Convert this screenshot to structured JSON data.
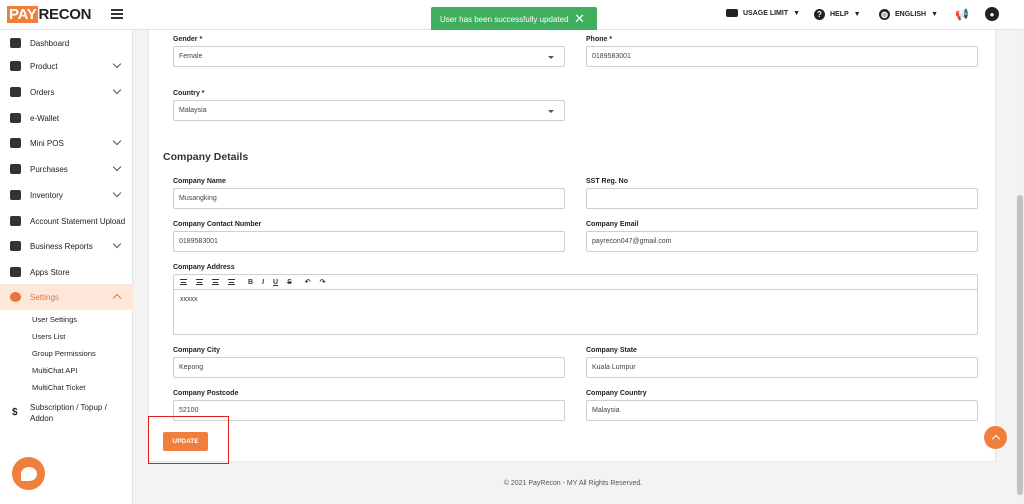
{
  "app": {
    "logo_pay": "PAY",
    "logo_recon": "RECON"
  },
  "toast": {
    "message": "User has been successfully updated",
    "close_icon": "close-icon"
  },
  "header": {
    "usage_limit": "USAGE LIMIT",
    "help": "HELP",
    "language": "ENGLISH"
  },
  "sidebar": {
    "items": [
      {
        "label": "Dashboard",
        "icon": "chart-icon"
      },
      {
        "label": "Product",
        "icon": "box-icon"
      },
      {
        "label": "Orders",
        "icon": "clipboard-icon"
      },
      {
        "label": "e-Wallet",
        "icon": "wallet-icon"
      },
      {
        "label": "Mini POS",
        "icon": "pos-icon"
      },
      {
        "label": "Purchases",
        "icon": "truck-icon"
      },
      {
        "label": "Inventory",
        "icon": "boxes-icon"
      },
      {
        "label": "Account Statement Upload",
        "icon": "upload-icon"
      },
      {
        "label": "Business Reports",
        "icon": "pie-icon"
      },
      {
        "label": "Apps Store",
        "icon": "grid-icon"
      },
      {
        "label": "Settings",
        "icon": "gear-icon"
      }
    ],
    "sub_items": [
      "User Settings",
      "Users List",
      "Group Permissions",
      "MultiChat API",
      "MultiChat Ticket"
    ],
    "subscription": {
      "label_line1": "Subscription / Topup /",
      "label_line2": "Addon"
    }
  },
  "form": {
    "gender": {
      "label": "Gender *",
      "value": "Female"
    },
    "phone": {
      "label": "Phone *",
      "value": "0189583001"
    },
    "country": {
      "label": "Country *",
      "value": "Malaysia"
    },
    "section_title": "Company Details",
    "company_name": {
      "label": "Company Name",
      "value": "Musangking"
    },
    "sst": {
      "label": "SST Reg. No",
      "value": ""
    },
    "company_contact": {
      "label": "Company Contact Number",
      "value": "0189583001"
    },
    "company_email": {
      "label": "Company Email",
      "value": "payrecon047@gmail.com"
    },
    "company_address": {
      "label": "Company Address",
      "value": "xxxxx"
    },
    "company_city": {
      "label": "Company City",
      "value": "Kepong"
    },
    "company_state": {
      "label": "Company State",
      "value": "Kuala Lumpur"
    },
    "company_postcode": {
      "label": "Company Postcode",
      "value": "52100"
    },
    "company_country": {
      "label": "Company Country",
      "value": "Malaysia"
    },
    "update_label": "UPDATE"
  },
  "footer": {
    "text": "© 2021 PayRecon - MY All Rights Reserved."
  },
  "colors": {
    "accent": "#f07f3c",
    "toast": "#3fae5e",
    "highlight": "#e02020"
  }
}
